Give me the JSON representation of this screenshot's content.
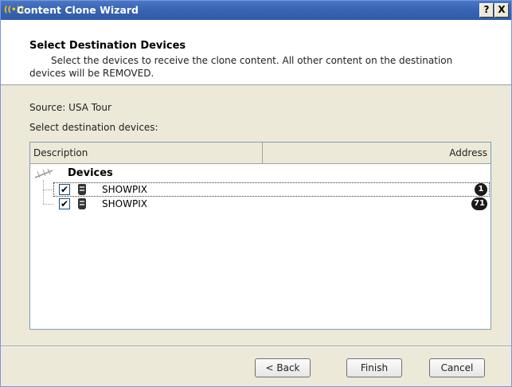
{
  "window": {
    "title": "Content Clone Wizard",
    "app_icon": "((•))",
    "help_label": "?",
    "close_label": "X"
  },
  "header": {
    "title": "Select Destination Devices",
    "desc_line1": "Select the devices to receive the clone content.  All other content on the destination",
    "desc_line2": "devices will be REMOVED."
  },
  "source": {
    "text": "Source:  USA Tour"
  },
  "select_label": "Select destination devices:",
  "listview": {
    "columns": {
      "description": "Description",
      "address": "Address"
    },
    "root": {
      "label": "Devices",
      "icon": "network-tree-icon"
    },
    "rows": [
      {
        "name": "SHOWPIX",
        "checked": true,
        "address": "1",
        "icon": "device-icon"
      },
      {
        "name": "SHOWPIX",
        "checked": true,
        "address": "71",
        "icon": "device-icon"
      }
    ]
  },
  "buttons": {
    "back": "< Back",
    "finish": "Finish",
    "cancel": "Cancel"
  },
  "colors": {
    "titlebar": "#3a66b5",
    "dialog_bg": "#ece9d8",
    "list_border": "#7f9db9"
  }
}
